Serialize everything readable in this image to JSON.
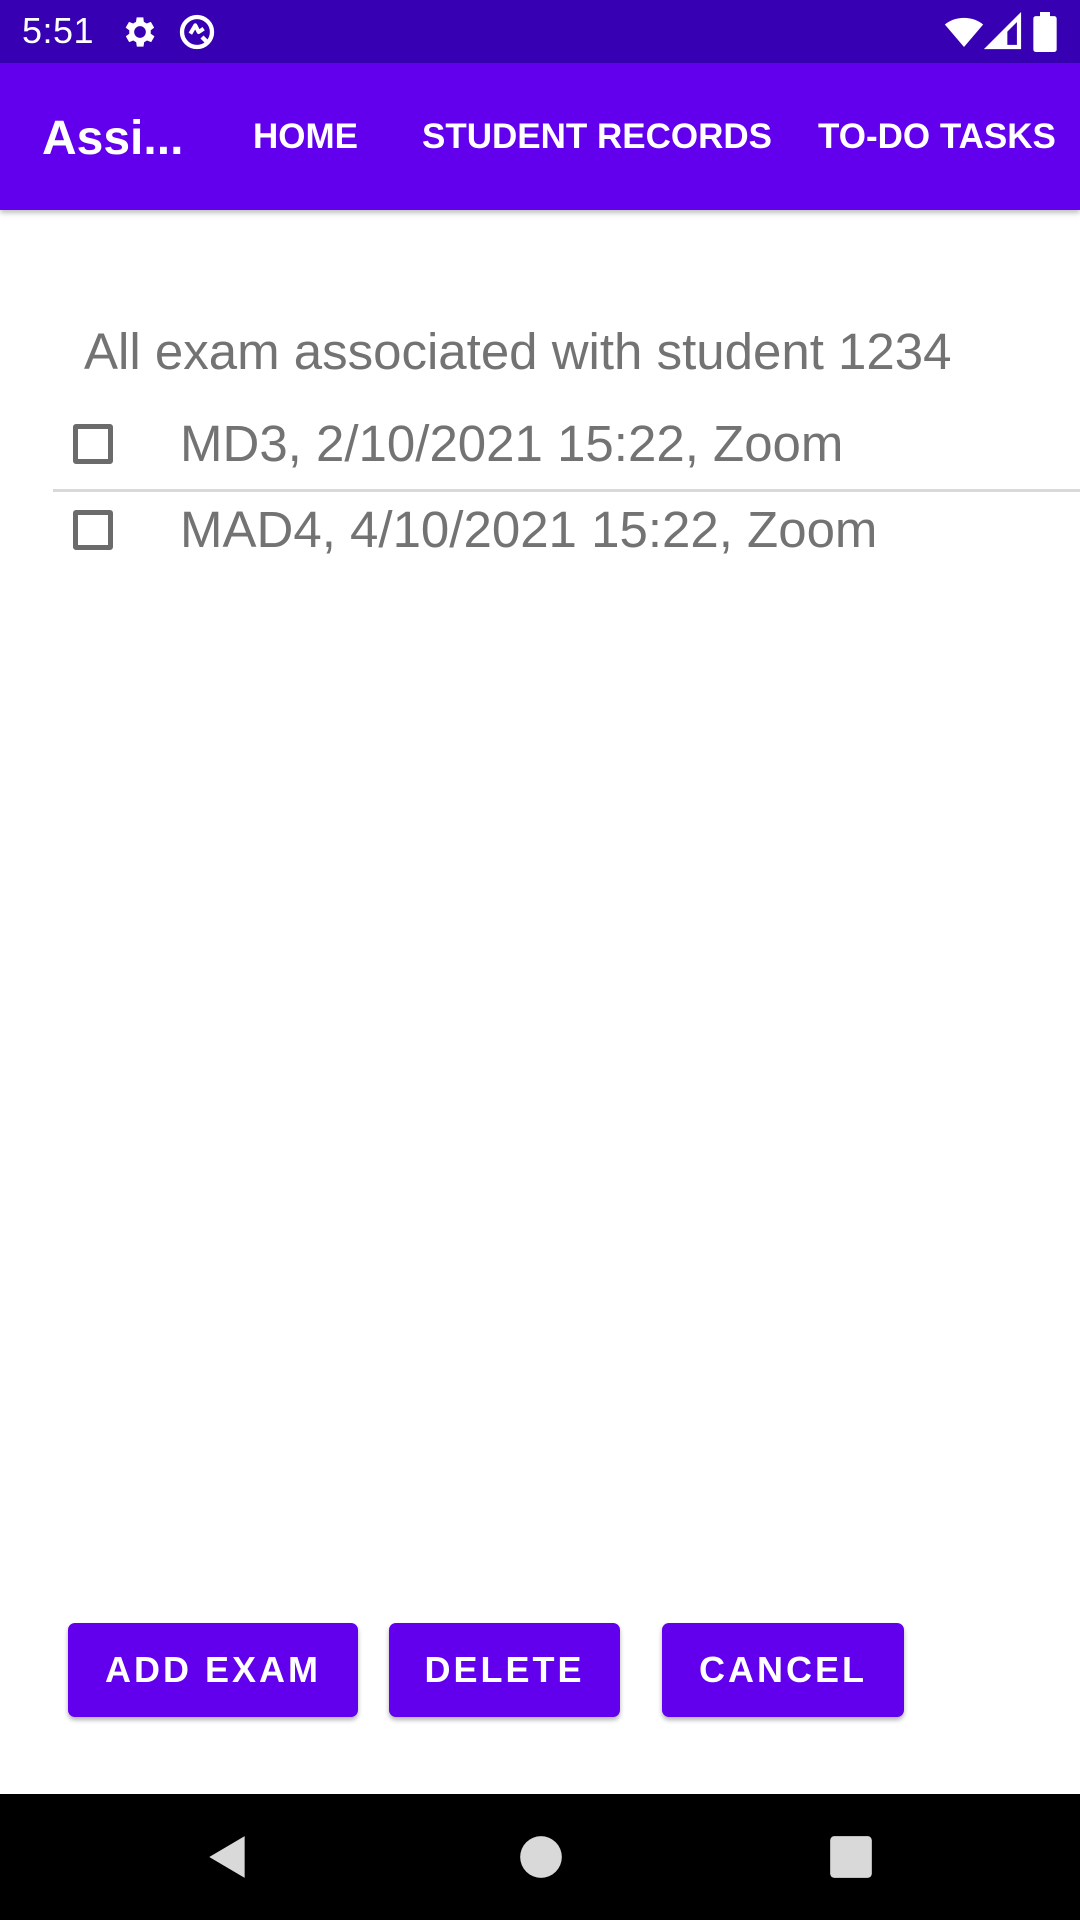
{
  "status_bar": {
    "time": "5:51",
    "left_icons": [
      "gear-icon",
      "sync-icon"
    ],
    "right_icons": [
      "wifi-icon",
      "cell-signal-icon",
      "battery-icon"
    ]
  },
  "app_bar": {
    "title": "Assi...",
    "menu": [
      {
        "label": "HOME"
      },
      {
        "label": "STUDENT RECORDS"
      },
      {
        "label": "TO-DO TASKS"
      }
    ],
    "background": "#6200ee"
  },
  "content": {
    "heading": "All exam associated with student 1234",
    "items": [
      {
        "label": "MD3, 2/10/2021 15:22, Zoom",
        "checked": false
      },
      {
        "label": "MAD4, 4/10/2021 15:22, Zoom",
        "checked": false
      }
    ]
  },
  "actions": {
    "add_exam": "ADD EXAM",
    "delete": "DELETE",
    "cancel": "CANCEL"
  },
  "nav_bar": {
    "icons": [
      "back-icon",
      "home-icon",
      "recents-icon"
    ]
  },
  "colors": {
    "status_bar": "#3700b3",
    "primary": "#6200ee",
    "text_secondary": "#737373"
  }
}
